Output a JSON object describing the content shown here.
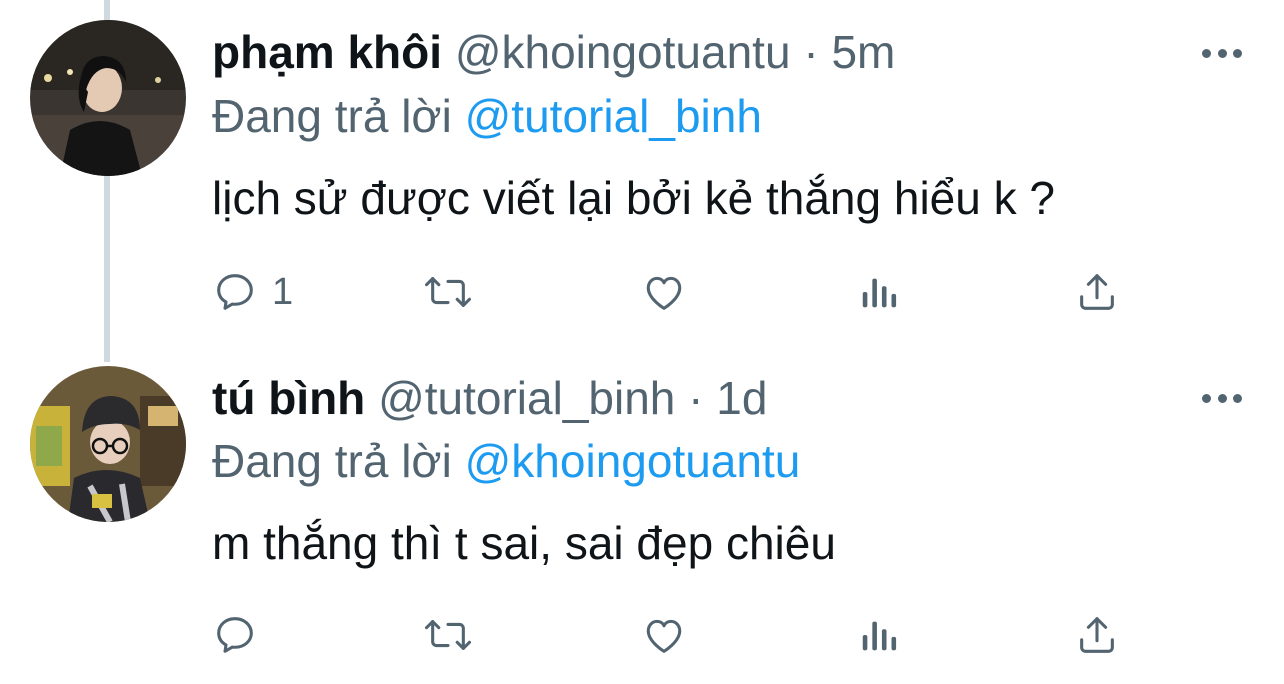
{
  "tweets": [
    {
      "display_name": "phạm khôi",
      "handle": "@khoingotuantu",
      "separator": "·",
      "time": "5m",
      "reply_prefix": "Đang trả lời",
      "reply_to": "@tutorial_binh",
      "text": "lịch sử được viết lại bởi kẻ thắng hiểu k ?",
      "reply_count": "1",
      "icons": [
        "reply-icon",
        "retweet-icon",
        "like-icon",
        "views-icon",
        "share-icon",
        "more-icon"
      ]
    },
    {
      "display_name": "tú bình",
      "handle": "@tutorial_binh",
      "separator": "·",
      "time": "1d",
      "reply_prefix": "Đang trả lời",
      "reply_to": "@khoingotuantu",
      "text": "m thắng thì t sai, sai đẹp chiêu",
      "reply_count": "",
      "icons": [
        "reply-icon",
        "retweet-icon",
        "like-icon",
        "views-icon",
        "share-icon",
        "more-icon"
      ]
    }
  ],
  "colors": {
    "text_primary": "#0f1419",
    "text_secondary": "#536471",
    "link": "#1d9bf0",
    "thread_line": "#cfd9de"
  }
}
